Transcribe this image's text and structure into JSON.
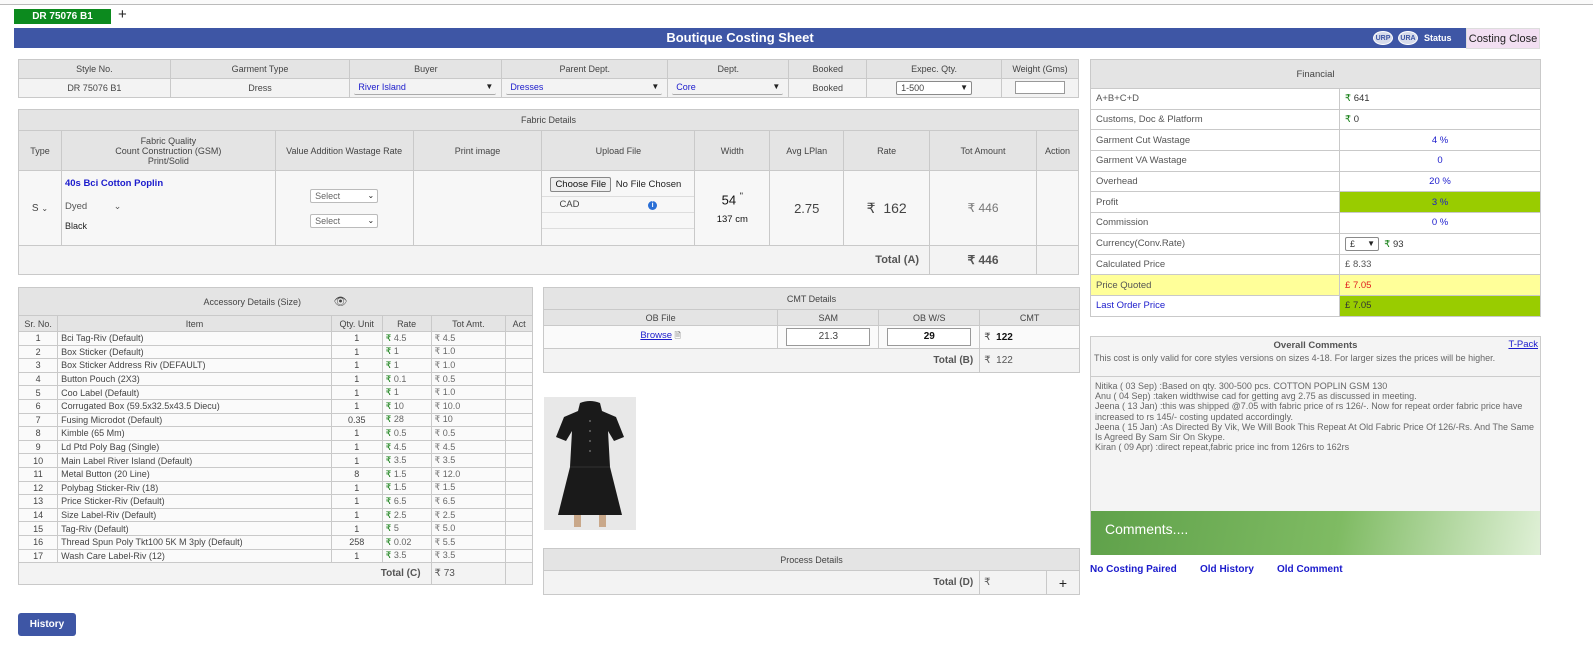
{
  "tab": {
    "label": "DR 75076 B1",
    "add": "+"
  },
  "title": "Boutique Costing Sheet",
  "badges": {
    "b1": "URP",
    "b2": "URA",
    "status": "Status"
  },
  "close_button": "Costing Close",
  "style": {
    "headers": [
      "Style No.",
      "Garment Type",
      "Buyer",
      "Parent Dept.",
      "Dept.",
      "Booked",
      "Expec. Qty.",
      "Weight (Gms)"
    ],
    "style_no": "DR 75076 B1",
    "garment_type": "Dress",
    "buyer": "River Island",
    "parent_dept": "Dresses",
    "dept": "Core",
    "booked": "Booked",
    "expec_qty": "1-500",
    "weight": ""
  },
  "fabric": {
    "title": "Fabric Details",
    "headers": {
      "type": "Type",
      "quality_l1": "Fabric Quality",
      "quality_l2": "Count Construction (GSM)",
      "quality_l3": "Print/Solid",
      "value_addition": "Value Addition Wastage Rate",
      "print_image": "Print image",
      "upload": "Upload File",
      "width": "Width",
      "avg": "Avg LPlan",
      "rate": "Rate",
      "tot": "Tot Amount",
      "action": "Action"
    },
    "type": "S",
    "quality": "40s Bci Cotton Poplin",
    "dyed": "Dyed",
    "color": "Black",
    "select1": "Select",
    "select2": "Select",
    "choose_file": "Choose File",
    "no_file": "No File Chosen",
    "cad": "CAD",
    "width_in": "54",
    "width_in_unit": "\"",
    "width_cm": "137 cm",
    "avg": "2.75",
    "rate": "162",
    "tot": "446",
    "total_label": "Total (A)",
    "total": "446"
  },
  "accessory": {
    "title": "Accessory Details (Size)",
    "headers": [
      "Sr. No.",
      "Item",
      "Qty. Unit",
      "Rate",
      "Tot Amt.",
      "Act"
    ],
    "rows": [
      {
        "sr": "1",
        "item": "Bci Tag-Riv (Default)",
        "qty": "1",
        "rate": "4.5",
        "tot": "4.5"
      },
      {
        "sr": "2",
        "item": "Box Sticker (Default)",
        "qty": "1",
        "rate": "1",
        "tot": "1.0"
      },
      {
        "sr": "3",
        "item": "Box Sticker Address Riv (DEFAULT)",
        "qty": "1",
        "rate": "1",
        "tot": "1.0"
      },
      {
        "sr": "4",
        "item": "Button Pouch (2X3)",
        "qty": "1",
        "rate": "0.1",
        "tot": "0.5"
      },
      {
        "sr": "5",
        "item": "Coo Label (Default)",
        "qty": "1",
        "rate": "1",
        "tot": "1.0"
      },
      {
        "sr": "6",
        "item": "Corrugated Box (59.5x32.5x43.5 Diecu)",
        "qty": "1",
        "rate": "10",
        "tot": "10.0"
      },
      {
        "sr": "7",
        "item": "Fusing Microdot (Default)",
        "qty": "0.35",
        "rate": "28",
        "tot": "10"
      },
      {
        "sr": "8",
        "item": "Kimble (65 Mm)",
        "qty": "1",
        "rate": "0.5",
        "tot": "0.5"
      },
      {
        "sr": "9",
        "item": "Ld Ptd Poly Bag (Single)",
        "qty": "1",
        "rate": "4.5",
        "tot": "4.5"
      },
      {
        "sr": "10",
        "item": "Main Label River Island (Default)",
        "qty": "1",
        "rate": "3.5",
        "tot": "3.5"
      },
      {
        "sr": "11",
        "item": "Metal Button (20 Line)",
        "qty": "8",
        "rate": "1.5",
        "tot": "12.0"
      },
      {
        "sr": "12",
        "item": "Polybag Sticker-Riv (18)",
        "qty": "1",
        "rate": "1.5",
        "tot": "1.5"
      },
      {
        "sr": "13",
        "item": "Price Sticker-Riv (Default)",
        "qty": "1",
        "rate": "6.5",
        "tot": "6.5"
      },
      {
        "sr": "14",
        "item": "Size Label-Riv (Default)",
        "qty": "1",
        "rate": "2.5",
        "tot": "2.5"
      },
      {
        "sr": "15",
        "item": "Tag-Riv (Default)",
        "qty": "1",
        "rate": "5",
        "tot": "5.0"
      },
      {
        "sr": "16",
        "item": "Thread Spun Poly Tkt100 5K M 3ply (Default)",
        "qty": "258",
        "rate": "0.02",
        "tot": "5.5"
      },
      {
        "sr": "17",
        "item": "Wash Care Label-Riv (12)",
        "qty": "1",
        "rate": "3.5",
        "tot": "3.5"
      }
    ],
    "total_label": "Total (C)",
    "total": "73"
  },
  "cmt": {
    "title": "CMT Details",
    "headers": [
      "OB File",
      "SAM",
      "OB W/S",
      "CMT"
    ],
    "browse": "Browse",
    "sam": "21.3",
    "ob_ws": "29",
    "cmt": "122",
    "total_label": "Total (B)",
    "total": "122"
  },
  "process": {
    "title": "Process Details",
    "total_label": "Total (D)",
    "total": "",
    "add": "+"
  },
  "financial": {
    "title": "Financial",
    "rows": [
      {
        "label": "A+B+C+D",
        "value": "641"
      },
      {
        "label": "Customs, Doc & Platform",
        "value": "0"
      },
      {
        "label": "Garment Cut Wastage",
        "value": "4 %"
      },
      {
        "label": "Garment VA Wastage",
        "value": "0"
      },
      {
        "label": "Overhead",
        "value": "20 %"
      },
      {
        "label": "Profit",
        "value": "3 %"
      },
      {
        "label": "Commission",
        "value": "0 %"
      },
      {
        "label": "Currency(Conv.Rate)",
        "value": "93",
        "currency": "£"
      },
      {
        "label": "Calculated Price",
        "value": "8.33"
      },
      {
        "label": "Price Quoted",
        "value": "7.05"
      },
      {
        "label": "Last Order Price",
        "value": "7.05"
      }
    ]
  },
  "comments": {
    "title": "Overall Comments",
    "tpack": "T-Pack",
    "note": "This cost is only valid for core styles versions on sizes 4-18. For larger sizes the prices will be higher.",
    "entries": [
      "Nitika ( 03 Sep) :Based on qty. 300-500 pcs. COTTON POPLIN GSM 130",
      "Anu ( 04 Sep) :taken widthwise cad for getting avg 2.75 as discussed in meeting.",
      "Jeena ( 13 Jan) :this was shipped @7.05 with fabric price of rs 126/-. Now for repeat order fabric price have increased to rs 145/- costing updated accordingly.",
      "Jeena ( 15 Jan) :As Directed By Vik, We Will Book This Repeat At Old Fabric Price Of 126/-Rs. And The Same Is Agreed By Sam Sir On Skype.",
      "Kiran ( 09 Apr) :direct repeat,fabric price inc from 126rs to 162rs"
    ],
    "input_placeholder": "Comments...."
  },
  "links": {
    "no_pair": "No Costing Paired",
    "old_history": "Old History",
    "old_comment": "Old Comment"
  },
  "history_button": "History",
  "symbols": {
    "rupee": "₹",
    "pound": "£"
  },
  "colors": {
    "title_bar": "#3e56a5",
    "tab": "#0c8a1e",
    "profit_bg": "#99cc00",
    "quoted_bg": "#ffff99",
    "quoted_text": "#e02020",
    "last_order_bg": "#99cc00"
  }
}
